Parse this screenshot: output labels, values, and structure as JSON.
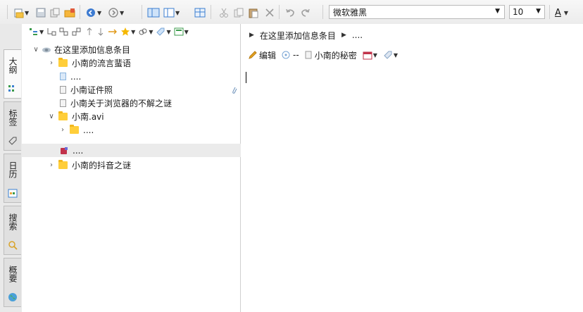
{
  "toolbar": {
    "font_name": "微软雅黑",
    "font_size": "10",
    "font_color_label": "A",
    "icons": [
      "new-note-icon",
      "save-icon",
      "copy-format-icon",
      "open-folder-icon",
      "back-icon",
      "forward-icon",
      "layout-icon",
      "layout-split-icon",
      "table-icon",
      "cut-icon",
      "copy-icon",
      "paste-icon",
      "delete-icon",
      "undo-icon",
      "redo-icon"
    ]
  },
  "side_tabs": [
    {
      "label": "大纲",
      "icon": "outline-icon"
    },
    {
      "label": "标签",
      "icon": "tag-icon"
    },
    {
      "label": "日历",
      "icon": "calendar-icon"
    },
    {
      "label": "搜索",
      "icon": "search-icon"
    },
    {
      "label": "概要",
      "icon": "globe-icon"
    }
  ],
  "tree": {
    "root": "在这里添加信息条目",
    "items": [
      {
        "label": "小南的流言蜚语"
      },
      {
        "label": "...."
      },
      {
        "label": "小南证件照"
      },
      {
        "label": "小南关于浏览器的不解之谜"
      },
      {
        "label": "小南.avi"
      },
      {
        "label": "...."
      },
      {
        "label": "...."
      },
      {
        "label": "小南的抖音之谜"
      }
    ]
  },
  "breadcrumb": {
    "item1": "在这里添加信息条目",
    "item2": "...."
  },
  "note_toolbar": {
    "edit_label": "编辑",
    "status_label": "--",
    "note_title": "小南的秘密"
  },
  "colors": {
    "folder": "#ffce3a",
    "accent_blue": "#3a7fd0",
    "toolbar_bg": "#efefef"
  }
}
